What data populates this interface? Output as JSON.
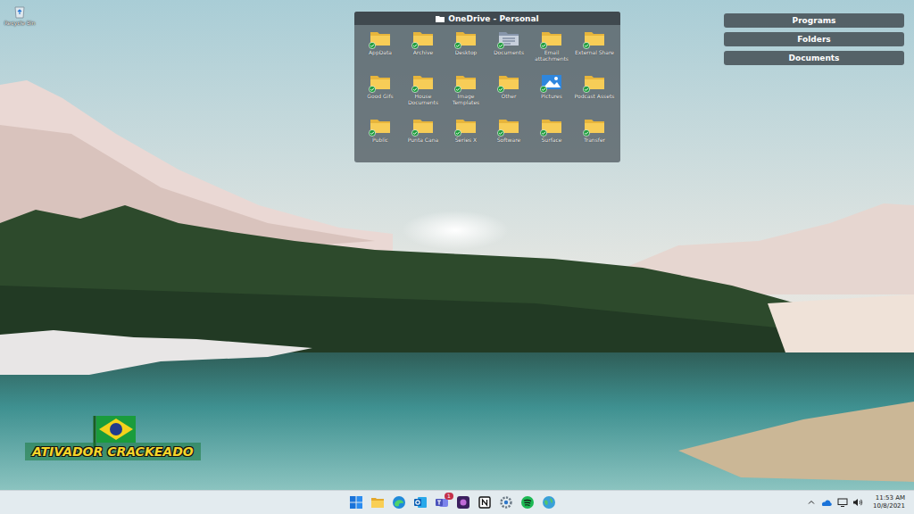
{
  "desktop_icons": [
    {
      "label": "Recycle Bin"
    }
  ],
  "fence": {
    "title": "OneDrive - Personal",
    "items": [
      {
        "label": "AppData",
        "kind": "folder",
        "synced": true
      },
      {
        "label": "Archive",
        "kind": "folder",
        "synced": true
      },
      {
        "label": "Desktop",
        "kind": "folder",
        "synced": true
      },
      {
        "label": "Documents",
        "kind": "documents",
        "synced": true
      },
      {
        "label": "Email attachments",
        "kind": "folder",
        "synced": true
      },
      {
        "label": "External Share",
        "kind": "folder",
        "synced": true
      },
      {
        "label": "Good Gifs",
        "kind": "folder",
        "synced": true
      },
      {
        "label": "House Documents",
        "kind": "folder",
        "synced": true
      },
      {
        "label": "Image Templates",
        "kind": "folder",
        "synced": true
      },
      {
        "label": "Other",
        "kind": "folder",
        "synced": true
      },
      {
        "label": "Pictures",
        "kind": "pictures",
        "synced": true
      },
      {
        "label": "Podcast Assets",
        "kind": "folder",
        "synced": true
      },
      {
        "label": "Public",
        "kind": "folder",
        "synced": true
      },
      {
        "label": "Punta Cana",
        "kind": "folder",
        "synced": true
      },
      {
        "label": "Series X",
        "kind": "folder",
        "synced": true
      },
      {
        "label": "Software",
        "kind": "folder",
        "synced": true
      },
      {
        "label": "Surface",
        "kind": "folder",
        "synced": true
      },
      {
        "label": "Transfer",
        "kind": "folder",
        "synced": true
      }
    ]
  },
  "collapsed_fences": [
    {
      "title": "Programs"
    },
    {
      "title": "Folders"
    },
    {
      "title": "Documents"
    }
  ],
  "watermark": {
    "text": "ATIVADOR CRACKEADO"
  },
  "taskbar": {
    "apps": [
      {
        "kind": "start",
        "badge": ""
      },
      {
        "kind": "explorer",
        "badge": ""
      },
      {
        "kind": "edge",
        "badge": ""
      },
      {
        "kind": "outlook",
        "badge": ""
      },
      {
        "kind": "teams",
        "badge": "1"
      },
      {
        "kind": "purple",
        "badge": ""
      },
      {
        "kind": "notion",
        "badge": ""
      },
      {
        "kind": "settings",
        "badge": ""
      },
      {
        "kind": "spotify",
        "badge": ""
      },
      {
        "kind": "globe",
        "badge": ""
      }
    ],
    "clock": {
      "time": "11:53 AM",
      "date": "10/8/2021"
    }
  }
}
